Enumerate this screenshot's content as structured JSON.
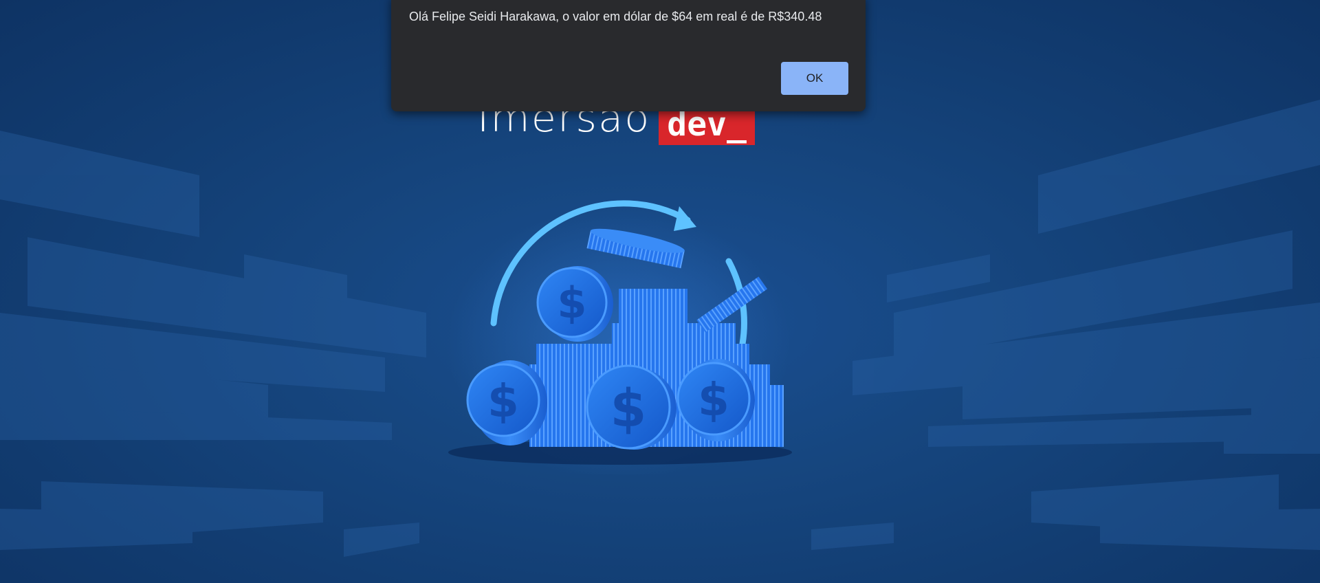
{
  "brand": {
    "text": "Imersão",
    "badge": "dev_",
    "badge_color": "#d9262b"
  },
  "illustration": {
    "icon": "dollar-coins-exchange-icon"
  },
  "alert": {
    "message": "Olá Felipe Seidi Harakawa, o valor em dólar de $64 em real é de R$340.48",
    "ok_label": "OK",
    "ok_color": "#8ab4f8",
    "background": "#292a2d"
  },
  "colors": {
    "page_background": "#16467f",
    "coin": "#1e6ee8"
  }
}
